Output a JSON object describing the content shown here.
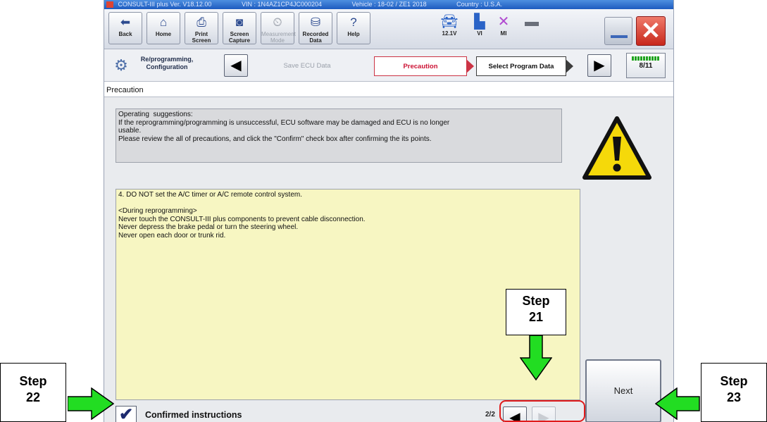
{
  "window": {
    "title_segments": [
      "CONSULT-III plus  Ver. V18.12.00",
      "VIN : 1N4AZ1CP4JC000204",
      "Vehicle : 18-02 / ZE1 2018",
      "Country : U.S.A."
    ]
  },
  "toolbar": {
    "back": "Back",
    "home": "Home",
    "print_screen": "Print Screen",
    "screen_capture": "Screen Capture",
    "measurement_mode": "Measurement Mode",
    "recorded_data": "Recorded Data",
    "help": "Help",
    "battery": "12.1V",
    "vi": "VI",
    "mi": "MI"
  },
  "nav": {
    "section_label": "Re/programming, Configuration",
    "steps": [
      "Save ECU Data",
      "Precaution",
      "Select Program Data"
    ],
    "progress_text": "8/11",
    "progress_fraction": 0.727
  },
  "page_title": "Precaution",
  "suggestions": {
    "lines": [
      "Operating  suggestions:",
      "If the reprogramming/programming is unsuccessful, ECU software may be damaged and ECU is no longer",
      "usable.",
      "Please review the all of precautions, and click the \"Confirm\" check box after confirming the its points."
    ]
  },
  "precaution_text": {
    "line1": "4. DO NOT set the A/C timer or A/C remote control system.",
    "line2": "<During  reprogramming>",
    "line3": "Never touch the CONSULT-III plus components to prevent cable disconnection.",
    "line4": "Never depress the brake pedal or turn the steering wheel.",
    "line5": "Never open each door or trunk rid."
  },
  "confirm": {
    "label": "Confirmed instructions",
    "checked": true
  },
  "pagination": {
    "indicator": "2/2"
  },
  "next_label": "Next",
  "annotations": {
    "step21": [
      "Step",
      "21"
    ],
    "step22": [
      "Step",
      "22"
    ],
    "step23": [
      "Step",
      "23"
    ]
  },
  "colors": {
    "accent_red": "#cc1133",
    "annotation_arrow": "#22dd22",
    "highlight_red": "#e01b1b",
    "text_box_bg": "#f7f6c2"
  }
}
